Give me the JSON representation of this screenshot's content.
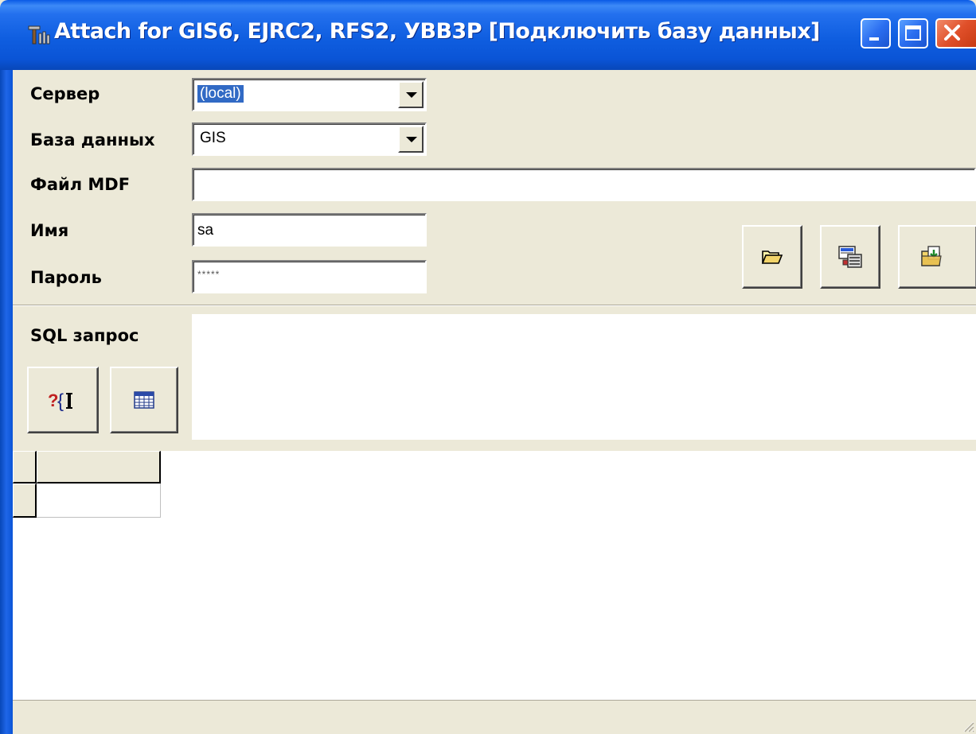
{
  "window": {
    "title": "Attach for GIS6, EJRC2, RFS2, УВВ3Р  [Подключить базу данных]",
    "icon": "app-tools-icon"
  },
  "controls": {
    "minimize": "minimize-icon",
    "maximize": "maximize-icon",
    "close": "close-icon"
  },
  "form": {
    "server_label": "Сервер",
    "server_value": "(local)",
    "database_label": "База данных",
    "database_value": "GIS",
    "mdf_label": "Файл MDF",
    "mdf_value": "",
    "name_label": "Имя",
    "name_value": "sa",
    "password_label": "Пароль",
    "password_value": "*****"
  },
  "toolbar": {
    "open_icon": "folder-open-icon",
    "connect_icon": "database-server-icon",
    "attach_icon": "import-icon"
  },
  "sql": {
    "label": "SQL запрос",
    "query_text": "",
    "execute_icon": "query-icon",
    "grid_icon": "table-grid-icon"
  },
  "colors": {
    "titlebar": "#0a54d6",
    "face": "#ece9d8",
    "selection": "#316ac5"
  }
}
